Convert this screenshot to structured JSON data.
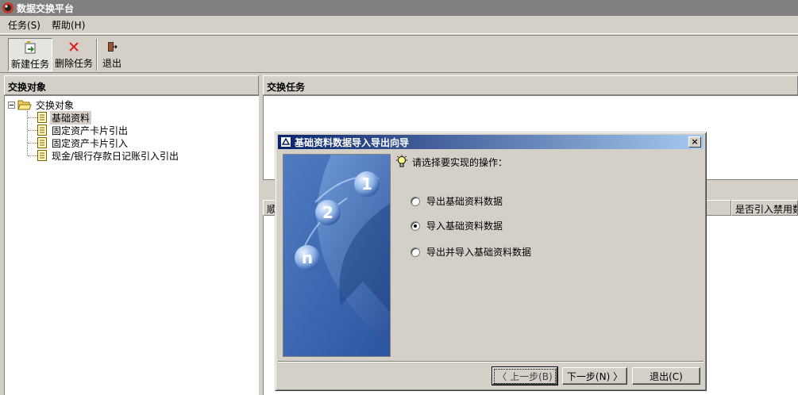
{
  "window": {
    "title": "数据交换平台"
  },
  "menu": [
    {
      "label": "任务(S)"
    },
    {
      "label": "帮助(H)"
    }
  ],
  "toolbar": {
    "new_task": "新建任务",
    "delete_task": "删除任务",
    "exit": "退出"
  },
  "left_panel": {
    "title": "交换对象",
    "tree": {
      "root": "交换对象",
      "children": [
        "基础资料",
        "固定资产卡片引出",
        "固定资产卡片引入",
        "现金/银行存款日记账引入引出"
      ],
      "selected_index": 0
    }
  },
  "right_panel": {
    "title": "交换任务",
    "grid_columns": [
      "顺",
      "是否引入禁用数"
    ]
  },
  "dialog": {
    "title": "基础资料数据导入导出向导",
    "close": "×",
    "prompt": "请选择要实现的操作：",
    "options": [
      {
        "label": "导出基础资料数据",
        "checked": false
      },
      {
        "label": "导入基础资料数据",
        "checked": true
      },
      {
        "label": "导出并导入基础资料数据",
        "checked": false
      }
    ],
    "buttons": {
      "back": "〈 上一步(B)",
      "next": "下一步(N) 〉",
      "exit": "退出(C)"
    },
    "art_numbers": [
      "1",
      "2",
      "n"
    ]
  },
  "colors": {
    "face": "#d4d0c8",
    "title_active_start": "#0a246a",
    "title_active_end": "#a6caf0",
    "title_inactive": "#808080"
  }
}
